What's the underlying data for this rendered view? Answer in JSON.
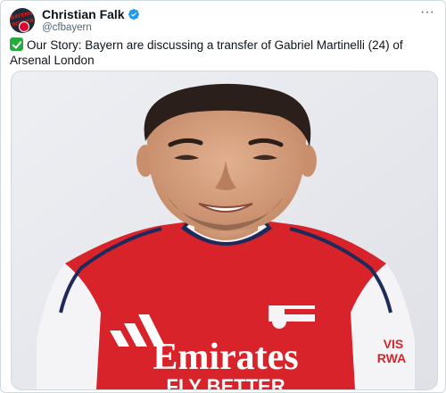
{
  "tweet": {
    "author_name": "Christian Falk",
    "author_handle": "@cfbayern",
    "verified": true,
    "more_label": "···",
    "avatar_text": "BAYERN INSIDER",
    "text": "Our Story: Bayern are discussing a transfer of Gabriel Martinelli (24) of Arsenal London",
    "status_icon": "check-mark-button-icon"
  },
  "media": {
    "kit_sponsor_line1": "Emirates",
    "kit_sponsor_line2": "FLY BETTER",
    "sleeve_text_line1": "VIS",
    "sleeve_text_line2": "RWA",
    "colors": {
      "shirt_red": "#d8232a",
      "shirt_white": "#f4f4f6",
      "trim_navy": "#1f2a5a",
      "background": "#e9eaef"
    }
  }
}
